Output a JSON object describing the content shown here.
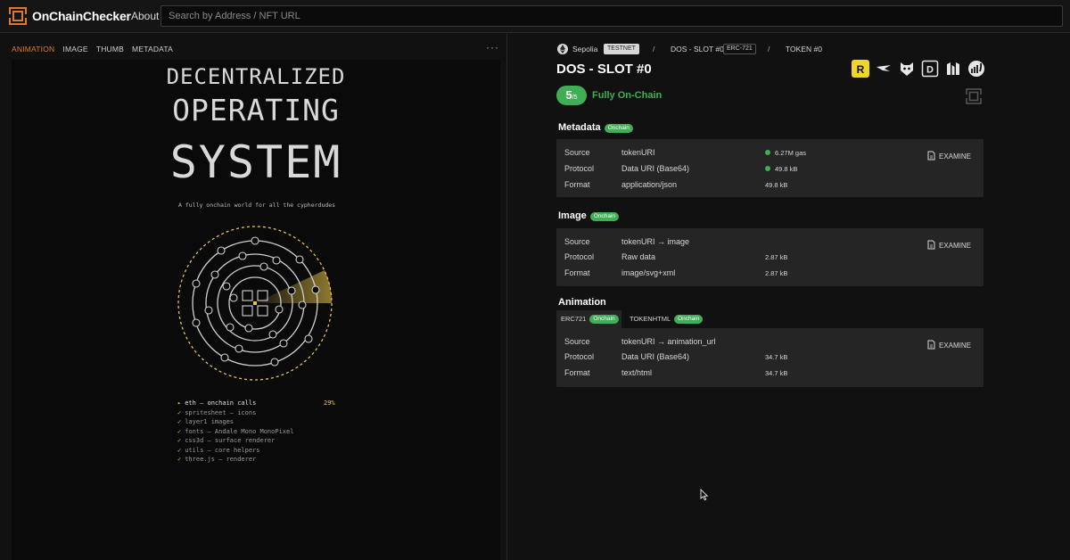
{
  "app": {
    "name": "OnChainChecker",
    "nav_about": "About",
    "search_placeholder": "Search by Address / NFT URL"
  },
  "left": {
    "tabs": [
      "ANIMATION",
      "IMAGE",
      "THUMB",
      "METADATA"
    ],
    "active_tab": "ANIMATION",
    "more_label": "···",
    "preview": {
      "heading_line1": "DECENTRALIZED",
      "heading_line2": "OPERATING",
      "heading_line3": "SYSTEM",
      "tagline": "A fully onchain world for all the cypherdudes",
      "log": {
        "current": {
          "marker": "▸",
          "text": "eth — onchain calls",
          "percent": "29%"
        },
        "done": [
          "spritesheet — icons",
          "layer1 images",
          "fonts — Andale Mono MonoPixel",
          "css3d — surface renderer",
          "utils — core helpers",
          "three.js — renderer"
        ],
        "check_mark": "✓"
      }
    }
  },
  "right": {
    "network": "Sepolia",
    "network_badge": "TESTNET",
    "separator": "/",
    "collection": "DOS - SLOT #0",
    "standard": "ERC-721",
    "token": "TOKEN #0",
    "title": "DOS - SLOT #0",
    "external_icons": [
      "rarible-icon",
      "opensea-icon",
      "looksrare-icon",
      "dune-icon",
      "zora-icon",
      "etherscan-icon"
    ],
    "score": {
      "value": "5",
      "total": "/5",
      "label": "Fully On-Chain"
    },
    "sections": {
      "metadata": {
        "title": "Metadata",
        "badge": "Onchain",
        "rows": [
          {
            "key": "Source",
            "value": "tokenURI",
            "meta": "6.27M gas"
          },
          {
            "key": "Protocol",
            "value": "Data URI (Base64)",
            "meta": "49.8 kB"
          },
          {
            "key": "Format",
            "value": "application/json",
            "meta": "49.8 kB"
          }
        ],
        "action": "EXAMINE"
      },
      "image": {
        "title": "Image",
        "badge": "Onchain",
        "rows": [
          {
            "key": "Source",
            "value": "tokenURI → image"
          },
          {
            "key": "Protocol",
            "value": "Raw data",
            "meta": "2.87 kB"
          },
          {
            "key": "Format",
            "value": "image/svg+xml",
            "meta": "2.87 kB"
          }
        ],
        "action": "EXAMINE"
      },
      "animation": {
        "title": "Animation",
        "tabs": [
          {
            "label": "ERC721",
            "badge": "Onchain"
          },
          {
            "label": "TOKENHTML",
            "badge": "Onchain"
          }
        ],
        "rows": [
          {
            "key": "Source",
            "value": "tokenURI → animation_url"
          },
          {
            "key": "Protocol",
            "value": "Data URI (Base64)",
            "meta": "34.7 kB"
          },
          {
            "key": "Format",
            "value": "text/html",
            "meta": "34.7 kB"
          }
        ],
        "action": "EXAMINE"
      }
    }
  },
  "colors": {
    "accent_orange": "#e07a2a",
    "onchain_green": "#3fae54",
    "background": "#111111",
    "card": "#252525"
  }
}
